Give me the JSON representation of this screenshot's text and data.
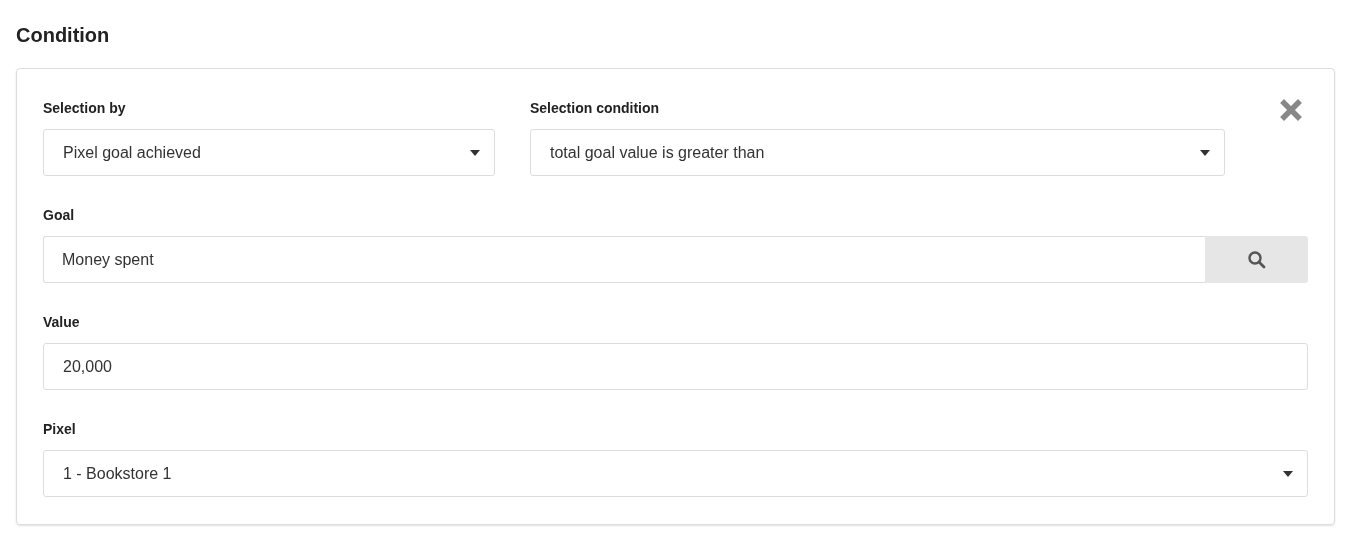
{
  "heading": "Condition",
  "top_fields": [
    {
      "label": "Selection by",
      "kind": "select",
      "value": "Pixel goal achieved"
    },
    {
      "label": "Selection condition",
      "kind": "select",
      "value": "total goal value is greater than"
    }
  ],
  "fields": [
    {
      "label": "Goal",
      "kind": "search",
      "value": "Money spent"
    },
    {
      "label": "Value",
      "kind": "text",
      "value": "20,000"
    },
    {
      "label": "Pixel",
      "kind": "select",
      "value": "1 - Bookstore 1"
    }
  ]
}
